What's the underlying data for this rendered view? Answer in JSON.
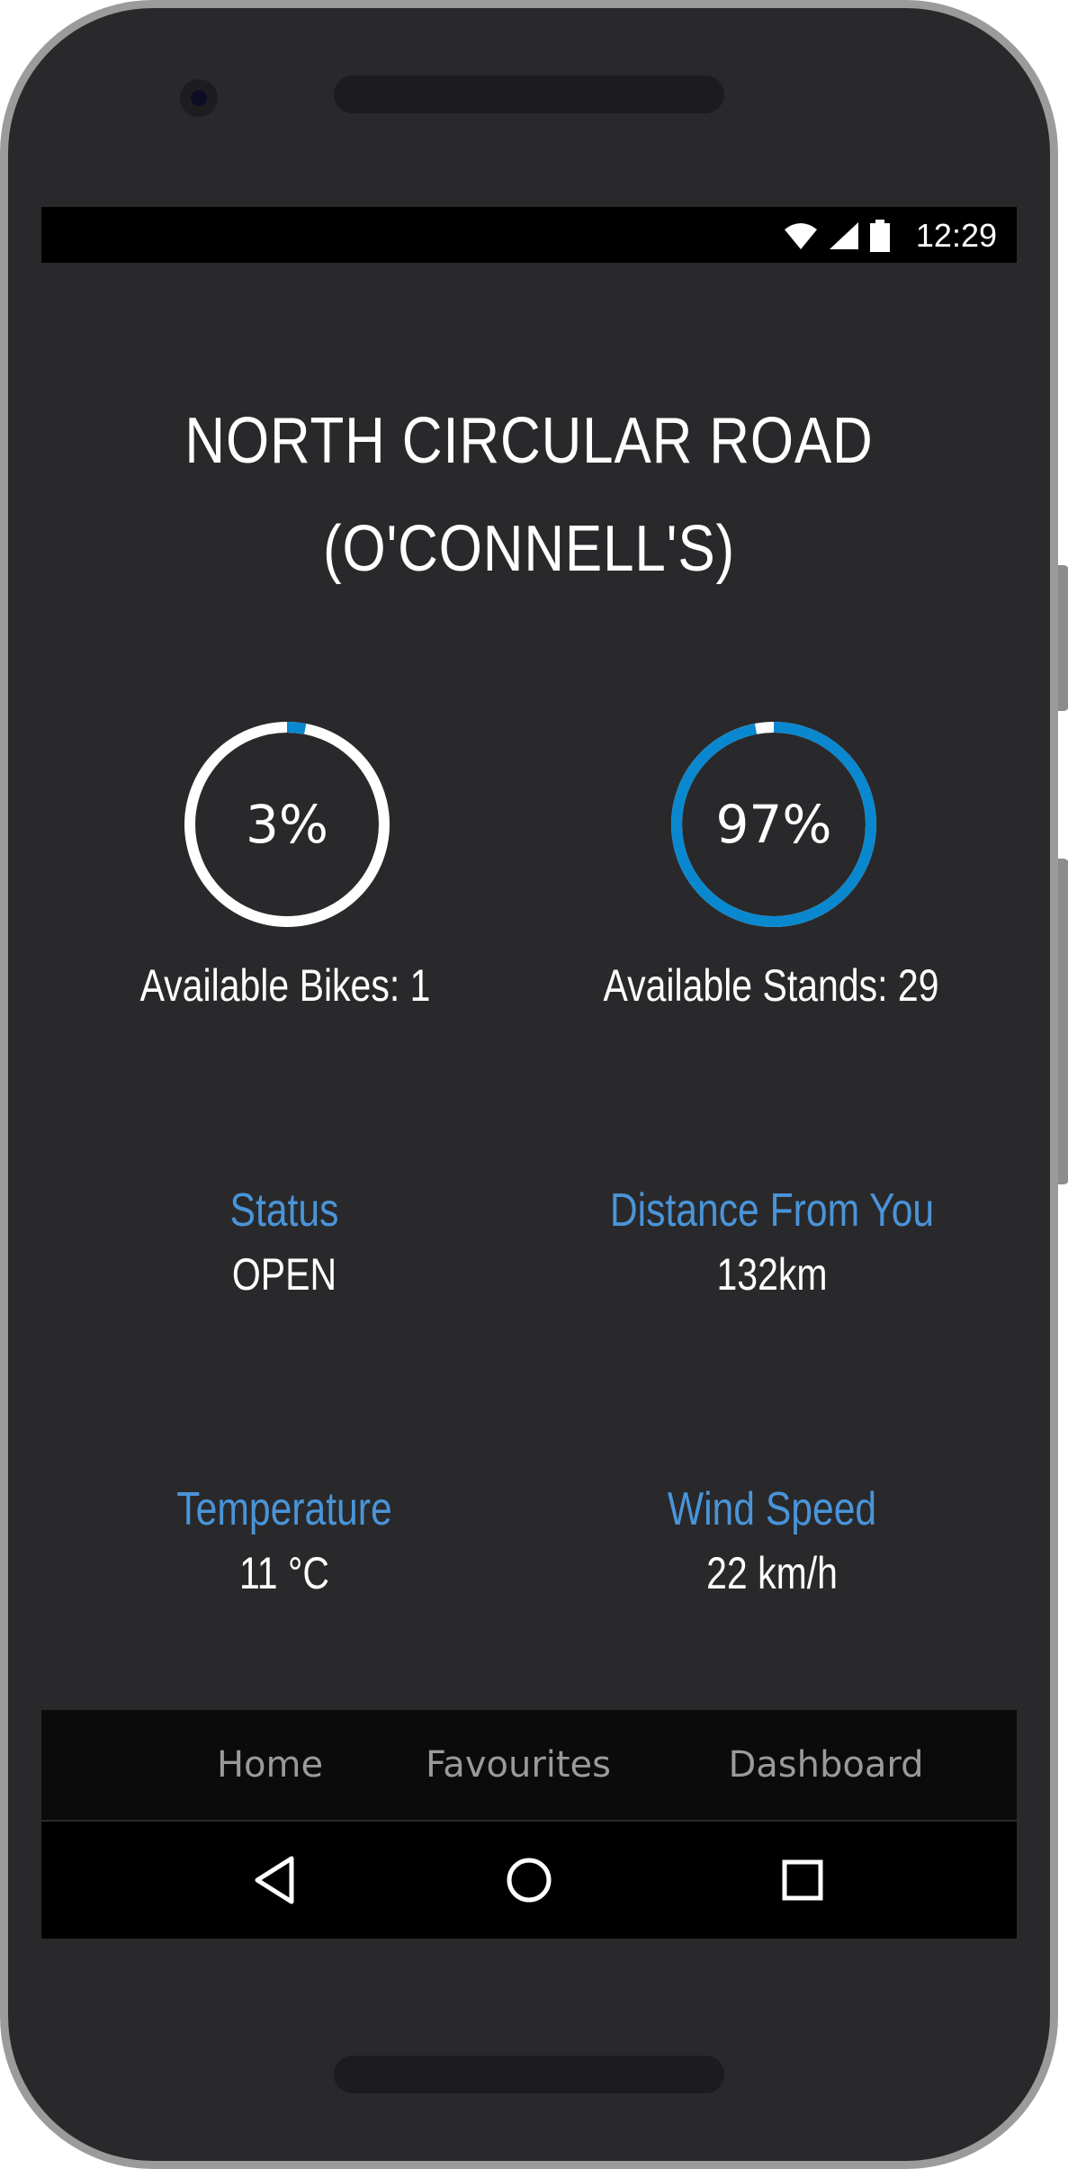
{
  "status_bar": {
    "time": "12:29",
    "icons": [
      "wifi-icon",
      "signal-icon",
      "battery-icon"
    ]
  },
  "station": {
    "name_line1": "NORTH CIRCULAR ROAD",
    "name_line2": "(O'CONNELL'S)"
  },
  "gauges": {
    "bikes": {
      "percent_label": "3%",
      "percent": 3,
      "label": "Available Bikes: 1"
    },
    "stands": {
      "percent_label": "97%",
      "percent": 97,
      "label": "Available Stands: 29"
    }
  },
  "info": {
    "status": {
      "label": "Status",
      "value": "OPEN"
    },
    "distance": {
      "label": "Distance From You",
      "value": "132km"
    },
    "temperature": {
      "label": "Temperature",
      "value": "11 °C"
    },
    "wind": {
      "label": "Wind Speed",
      "value": "22 km/h"
    }
  },
  "tabs": [
    {
      "label": "Home"
    },
    {
      "label": "Favourites"
    },
    {
      "label": "Dashboard"
    }
  ],
  "nav_icons": [
    "back-icon",
    "home-icon",
    "recents-icon"
  ],
  "colors": {
    "accent": "#0a88cf",
    "label_blue": "#4a94d8",
    "background": "#29292b",
    "ring_base": "#ffffff"
  }
}
